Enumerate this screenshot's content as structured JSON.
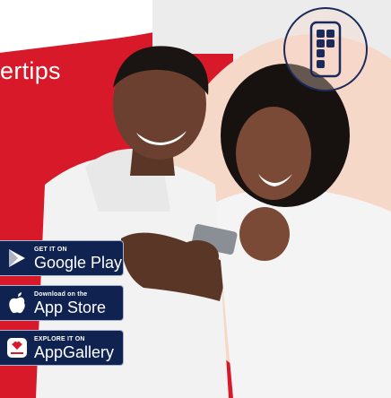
{
  "tagline": "ertips",
  "colors": {
    "brand_red": "#d8192a",
    "navy": "#0f2250",
    "peach": "#f6d8c9"
  },
  "badges": [
    {
      "small": "GET IT ON",
      "big": "Google Play",
      "icon": "google-play-icon"
    },
    {
      "small": "Download on the",
      "big": "App Store",
      "icon": "apple-icon"
    },
    {
      "small": "EXPLORE IT ON",
      "big": "AppGallery",
      "icon": "huawei-icon"
    }
  ],
  "phone_icon": "phone-app-grid-icon"
}
